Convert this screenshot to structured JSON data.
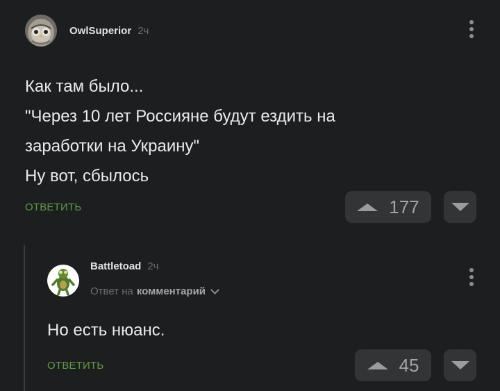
{
  "comments": [
    {
      "author": "OwlSuperior",
      "age": "2ч",
      "lines": [
        "Как там было...",
        "\"Через 10 лет Россияне будут ездить на",
        "заработки на Украину\"",
        "Ну вот, сбылось"
      ],
      "reply_label": "ОТВЕТИТЬ",
      "rating": "177",
      "avatar_icon": "owl-avatar-icon",
      "menu_icon": "kebab-menu-icon"
    },
    {
      "author": "Battletoad",
      "age": "2ч",
      "reply_to_prefix": "Ответ на",
      "reply_to_link": "комментарий",
      "text": "Но есть нюанс.",
      "reply_label": "ОТВЕТИТЬ",
      "rating": "45",
      "avatar_icon": "toad-avatar-icon",
      "menu_icon": "kebab-menu-icon"
    }
  ],
  "colors": {
    "background": "#1d1e20",
    "reply_link": "#5d9f3e",
    "vote_button": "#333436",
    "thread_line": "#3b3c3f"
  }
}
